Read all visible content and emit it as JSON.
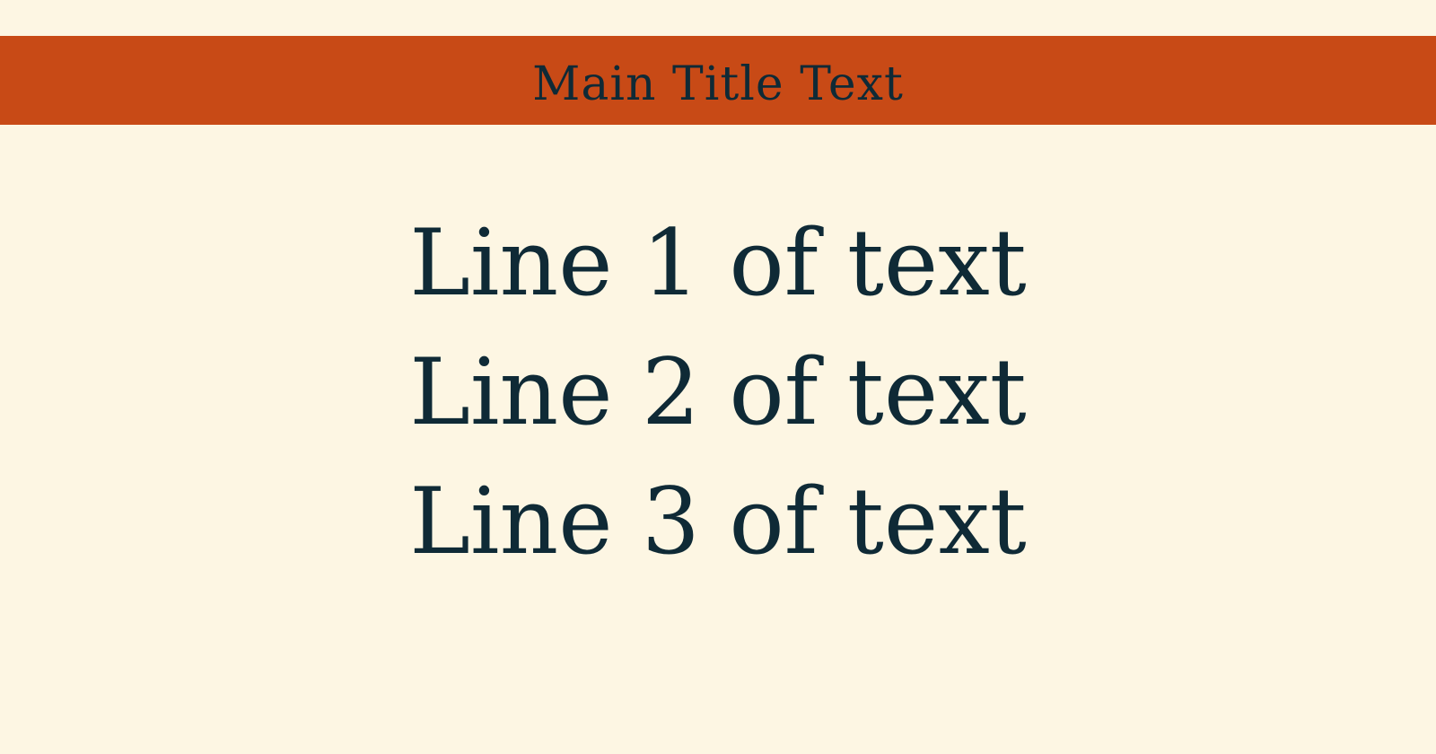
{
  "colors": {
    "background": "#fdf6e3",
    "title_bar": "#c84a16",
    "text": "#0f2a36"
  },
  "header": {
    "title": "Main Title Text"
  },
  "main": {
    "lines": [
      "Line 1 of text",
      "Line 2 of text",
      "Line 3 of text"
    ]
  }
}
